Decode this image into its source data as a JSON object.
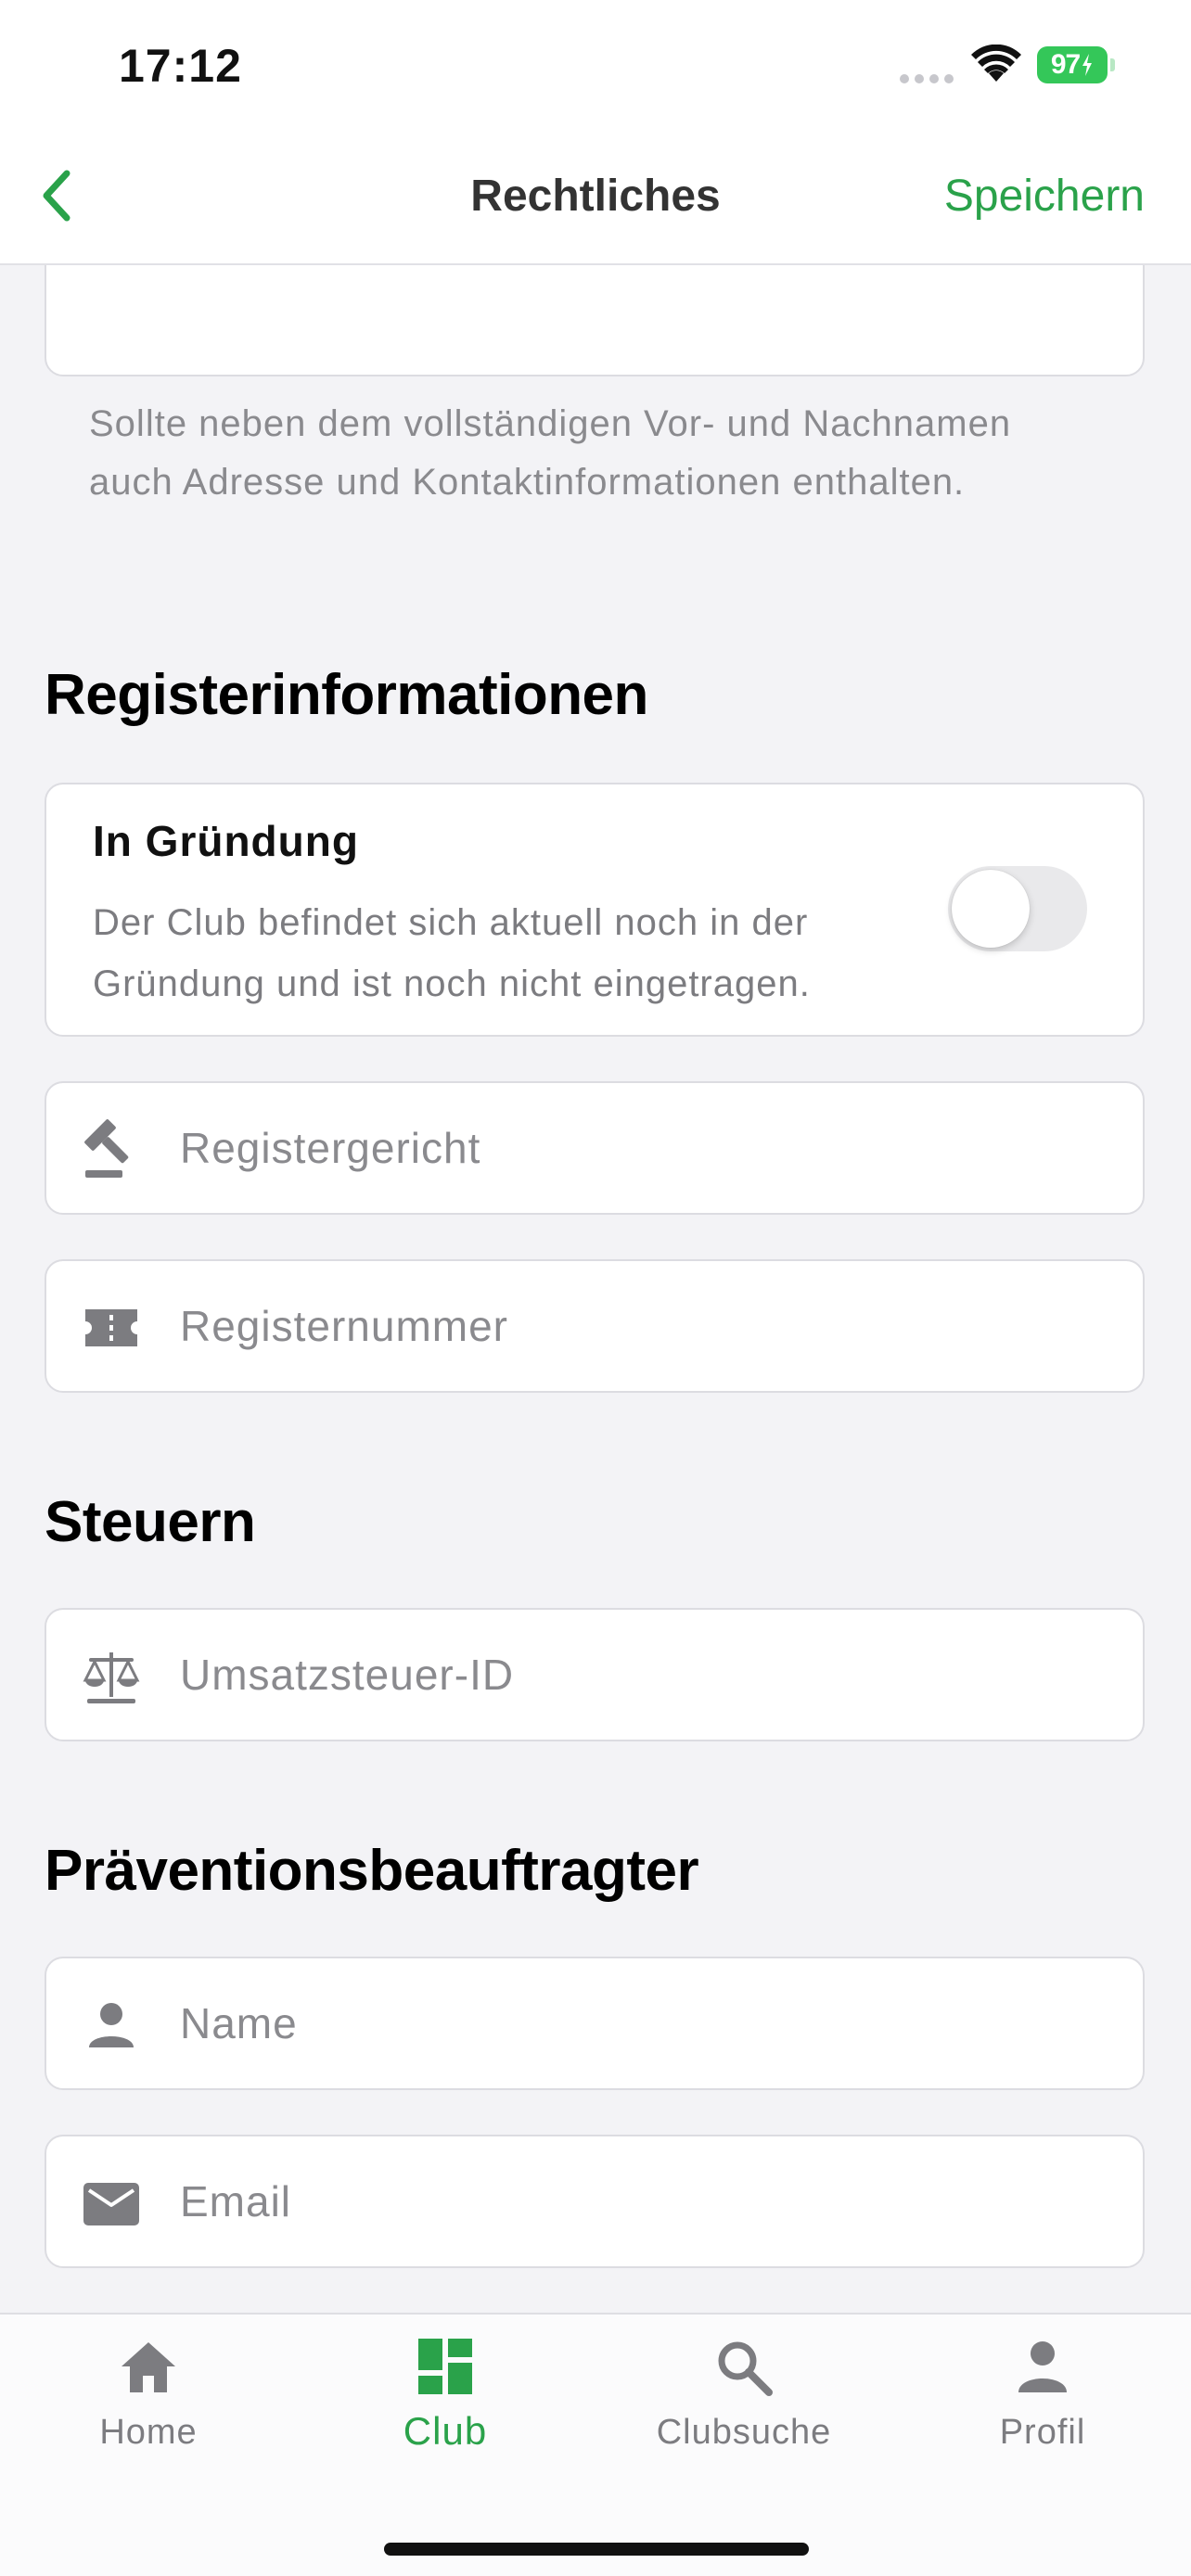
{
  "status_bar": {
    "time": "17:12",
    "battery": "97"
  },
  "nav": {
    "title": "Rechtliches",
    "save_label": "Speichern"
  },
  "helper": {
    "text": "Sollte neben dem vollständigen Vor- und Nachnamen auch Adresse und Kontaktinformationen enthalten."
  },
  "sections": {
    "register": {
      "title": "Registerinformationen",
      "in_gruendung": {
        "title": "In Gründung",
        "description": "Der Club befindet sich aktuell noch in der Gründung und ist noch nicht eingetragen.",
        "enabled": false
      },
      "registergericht_placeholder": "Registergericht",
      "registernummer_placeholder": "Registernummer"
    },
    "steuern": {
      "title": "Steuern",
      "umsatzsteuer_placeholder": "Umsatzsteuer-ID"
    },
    "praevention": {
      "title": "Präventionsbeauftragter",
      "name_placeholder": "Name",
      "email_placeholder": "Email"
    }
  },
  "tabs": [
    {
      "label": "Home",
      "icon": "home-icon",
      "active": false
    },
    {
      "label": "Club",
      "icon": "dashboard-icon",
      "active": true
    },
    {
      "label": "Clubsuche",
      "icon": "search-icon",
      "active": false
    },
    {
      "label": "Profil",
      "icon": "person-icon",
      "active": false
    }
  ],
  "colors": {
    "accent": "#2aa24a",
    "background": "#f3f3f6",
    "icon_gray": "#7c7c80"
  }
}
